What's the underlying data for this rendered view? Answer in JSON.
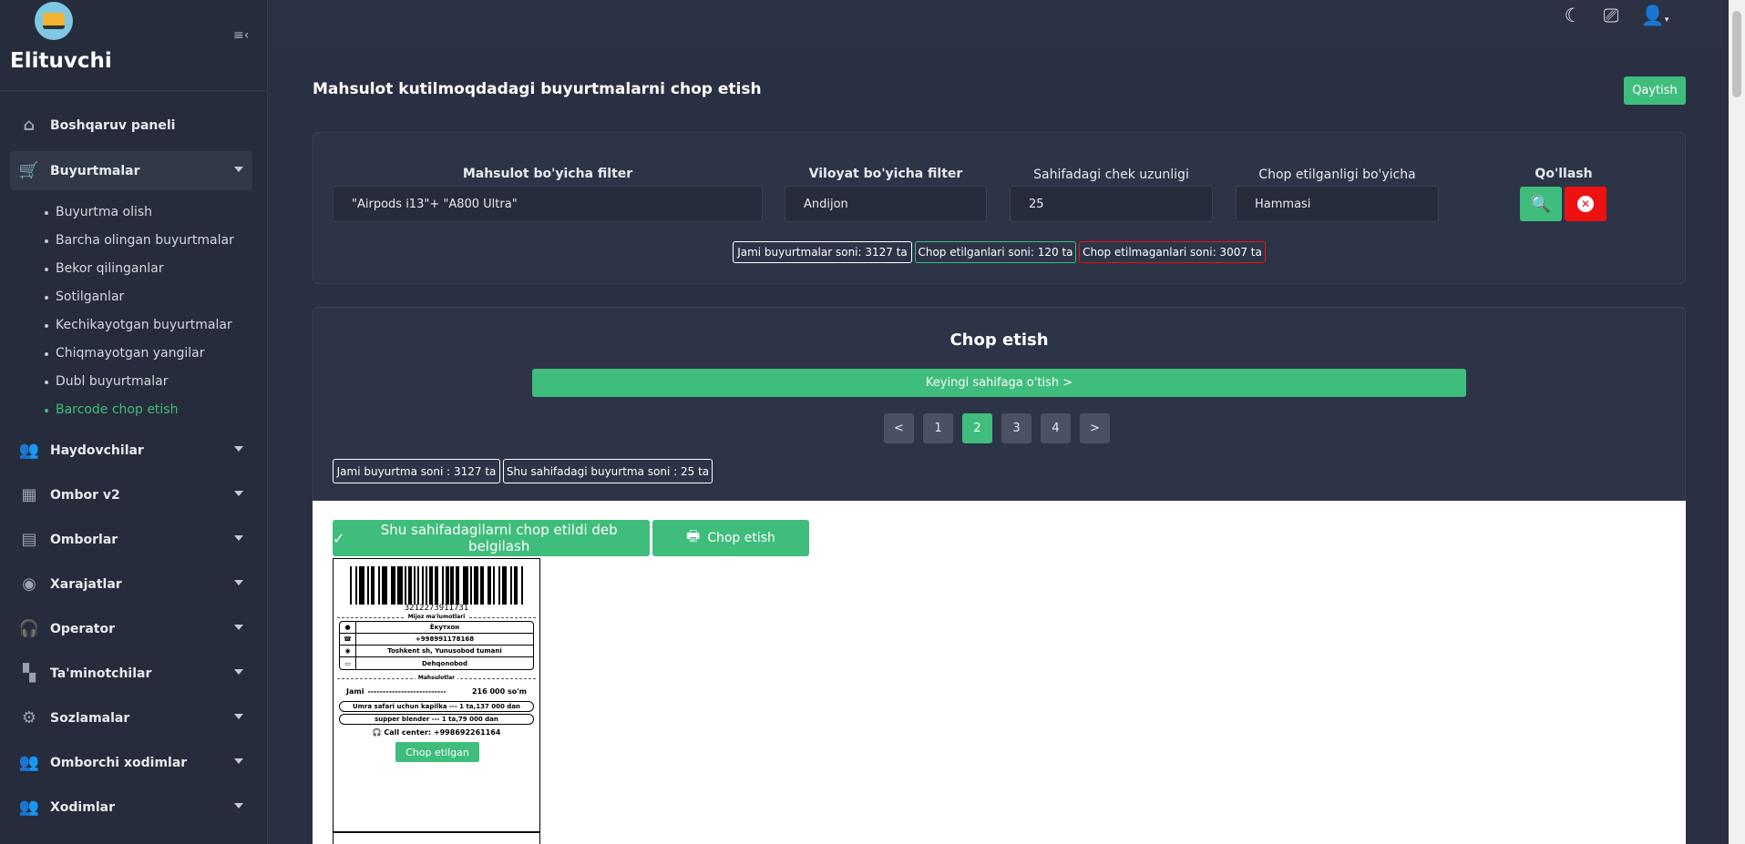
{
  "sidebar": {
    "brand": "Elituvchi",
    "items": [
      {
        "label": "Boshqaruv paneli",
        "icon": "home-icon"
      },
      {
        "label": "Buyurtmalar",
        "icon": "cart-icon"
      },
      {
        "label": "Haydovchilar",
        "icon": "people-icon"
      },
      {
        "label": "Ombor v2",
        "icon": "dashboard-icon"
      },
      {
        "label": "Omborlar",
        "icon": "store-icon"
      },
      {
        "label": "Xarajatlar",
        "icon": "explore-icon"
      },
      {
        "label": "Operator",
        "icon": "headset-icon"
      },
      {
        "label": "Ta'minotchilar",
        "icon": "widgets-icon"
      },
      {
        "label": "Sozlamalar",
        "icon": "gear-icon"
      },
      {
        "label": "Omborchi xodimlar",
        "icon": "people-icon"
      },
      {
        "label": "Xodimlar",
        "icon": "people-icon"
      }
    ],
    "sub_items": [
      "Buyurtma olish",
      "Barcha olingan buyurtmalar",
      "Bekor qilinganlar",
      "Sotilganlar",
      "Kechikayotgan buyurtmalar",
      "Chiqmayotgan yangilar",
      "Dubl buyurtmalar",
      "Barcode chop etish"
    ]
  },
  "page": {
    "title": "Mahsulot kutilmoqdadagi buyurtmalarni chop etish",
    "back_label": "Qaytish"
  },
  "filters": {
    "product_label": "Mahsulot bo'yicha filter",
    "product_value": "\"Airpods i13\"+ \"A800 Ultra\"",
    "region_label": "Viloyat bo'yicha filter",
    "region_value": "Andijon",
    "page_len_label": "Sahifadagi chek uzunligi",
    "page_len_value": "25",
    "printed_label": "Chop etilganligi bo'yicha",
    "printed_value": "Hammasi",
    "apply_label": "Qo'llash"
  },
  "stats": {
    "total": "Jami buyurtmalar soni: 3127 ta",
    "printed": "Chop etilganlari soni: 120 ta",
    "not_printed": "Chop etilmaganlari soni: 3007 ta"
  },
  "print": {
    "title": "Chop etish",
    "next_page_label": "Keyingi sahifaga o'tish >",
    "pagination": [
      "<",
      "1",
      "2",
      "3",
      "4",
      ">"
    ],
    "active_page": "2",
    "total_orders": "Jami buyurtma soni : 3127 ta",
    "page_orders": "Shu sahifadagi buyurtma soni : 25 ta",
    "mark_printed_label": "Shu sahifadagilarni chop etildi deb belgilash",
    "print_label": "Chop etish"
  },
  "label": {
    "barcode": "3212273911731",
    "client_caption": "Mijoz ma'lumotlari",
    "name": "Ёкутхон",
    "phone": "+998991178168",
    "address": "Toshkent sh, Yunusobod tumani",
    "landmark": "Dehqonobod",
    "products_caption": "Mahsulotlar",
    "total_label": "Jami",
    "total_dashes": "--------------------------",
    "total_value": "216 000 so'm",
    "products": [
      "Umra safari uchun kapilka --- 1 ta,137 000 dan",
      "supper blender --- 1 ta,79 000 dan"
    ],
    "call_center": "Call center: +998692261164",
    "status": "Chop etilgan"
  },
  "colors": {
    "accent": "#3fbd7c",
    "danger": "#ee1111",
    "sidebar_bg": "#262c3b",
    "content_bg": "#2a3041"
  }
}
